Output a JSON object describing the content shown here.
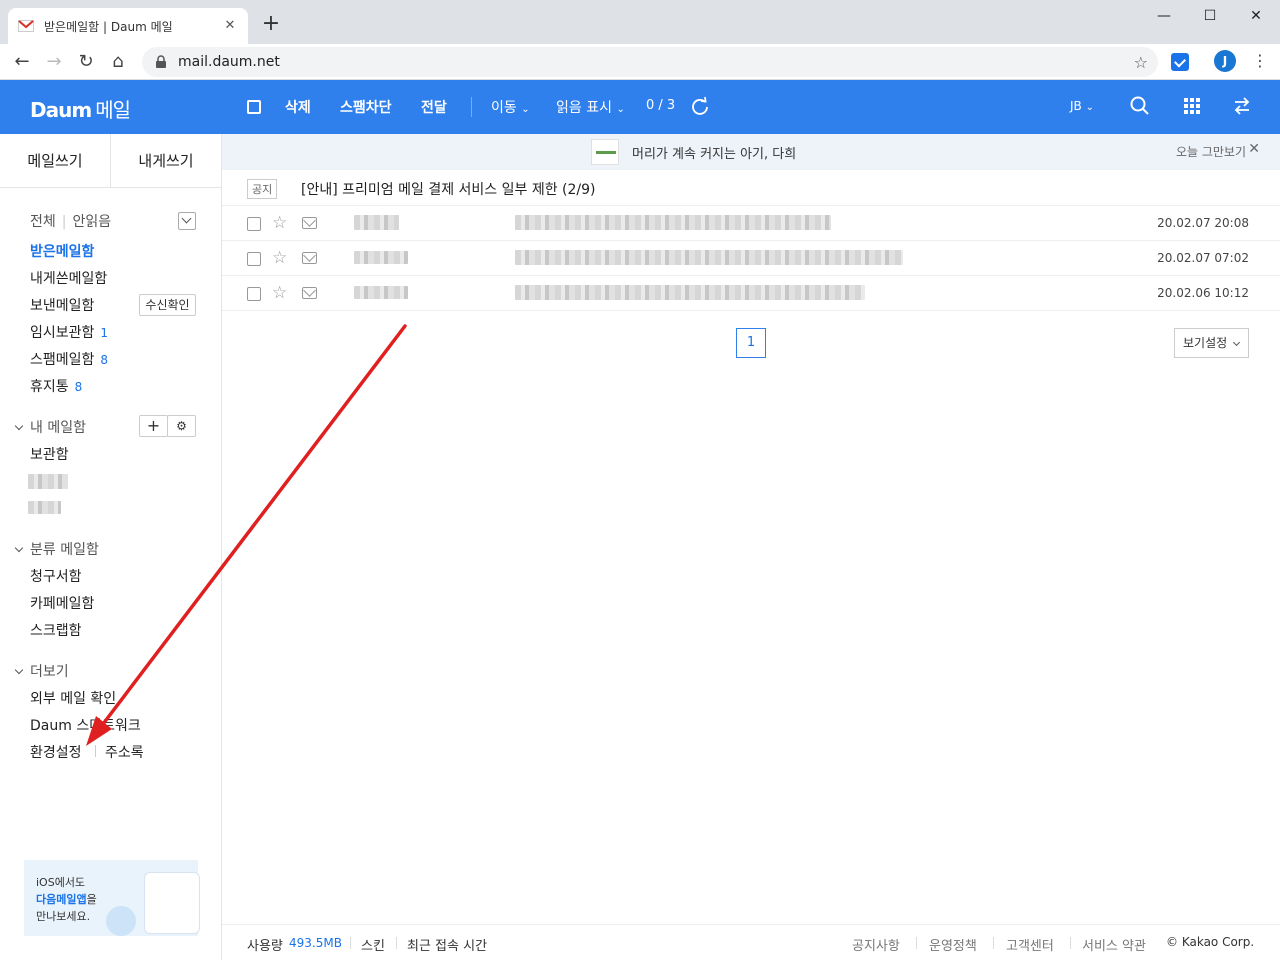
{
  "browser": {
    "tab_title": "받은메일함 | Daum 메일",
    "url": "mail.daum.net",
    "profile_initial": "J"
  },
  "header": {
    "logo": "Daum",
    "logo_suffix": "메일",
    "actions": {
      "delete": "삭제",
      "spam": "스팸차단",
      "forward": "전달",
      "move": "이동",
      "read_mark": "읽음 표시"
    },
    "selection_count": "0 / 3",
    "user": "JB"
  },
  "sidebar": {
    "compose": "메일쓰기",
    "compose_self": "내게쓰기",
    "filter_all": "전체",
    "filter_unread": "안읽음",
    "mailboxes": [
      {
        "label": "받은메일함",
        "count": ""
      },
      {
        "label": "내게쓴메일함",
        "count": ""
      },
      {
        "label": "보낸메일함",
        "count": ""
      },
      {
        "label": "임시보관함",
        "count": "1"
      },
      {
        "label": "스팸메일함",
        "count": "8"
      },
      {
        "label": "휴지통",
        "count": "8"
      }
    ],
    "receipt_check": "수신확인",
    "my_mailbox_header": "내 메일함",
    "my_mailbox_items": [
      "보관함"
    ],
    "category_header": "분류 메일함",
    "category_items": [
      "청구서함",
      "카페메일함",
      "스크랩함"
    ],
    "more_header": "더보기",
    "more_items": [
      "외부 메일 확인",
      "Daum 스마트워크"
    ],
    "settings": "환경설정",
    "address_book": "주소록",
    "promo_line1": "iOS에서도",
    "promo_highlight": "다음메일앱",
    "promo_line2": "을",
    "promo_line3": "만나보세요."
  },
  "main": {
    "ad_text": "머리가 계속 커지는 아기, 다희",
    "ad_close": "오늘 그만보기",
    "notice_tag": "공지",
    "notice_text": "[안내] 프리미엄 메일 결제 서비스 일부 제한 (2/9)",
    "messages": [
      {
        "date": "20.02.07 20:08"
      },
      {
        "date": "20.02.07 07:02"
      },
      {
        "date": "20.02.06 10:12"
      }
    ],
    "page": "1",
    "view_settings": "보기설정"
  },
  "footer": {
    "usage_label": "사용량",
    "usage_value": "493.5MB",
    "skin": "스킨",
    "last_login": "최근 접속 시간",
    "links": [
      "공지사항",
      "운영정책",
      "고객센터",
      "서비스 약관"
    ],
    "copyright": "© Kakao Corp."
  },
  "colors": {
    "brand": "#2f80ed",
    "link": "#1a73e8",
    "annotation_arrow": "#e02020"
  }
}
